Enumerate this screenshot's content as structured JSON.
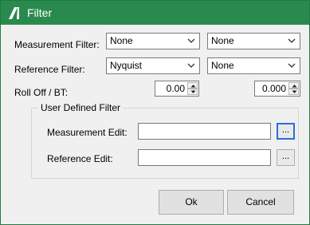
{
  "window": {
    "title": "Filter",
    "accent": "#2a8a4e"
  },
  "labels": {
    "measurement_filter": "Measurement Filter:",
    "reference_filter": "Reference Filter:",
    "roll_off": "Roll Off / BT:"
  },
  "measurement_filter": {
    "primary": "None",
    "secondary": "None"
  },
  "reference_filter": {
    "primary": "Nyquist",
    "secondary": "None"
  },
  "roll_off": {
    "primary": "0.00",
    "secondary": "0.000"
  },
  "user_defined": {
    "legend": "User Defined Filter",
    "measurement_edit_label": "Measurement Edit:",
    "measurement_edit_value": "",
    "reference_edit_label": "Reference Edit:",
    "reference_edit_value": "",
    "browse_label": "..."
  },
  "buttons": {
    "ok": "Ok",
    "cancel": "Cancel"
  }
}
